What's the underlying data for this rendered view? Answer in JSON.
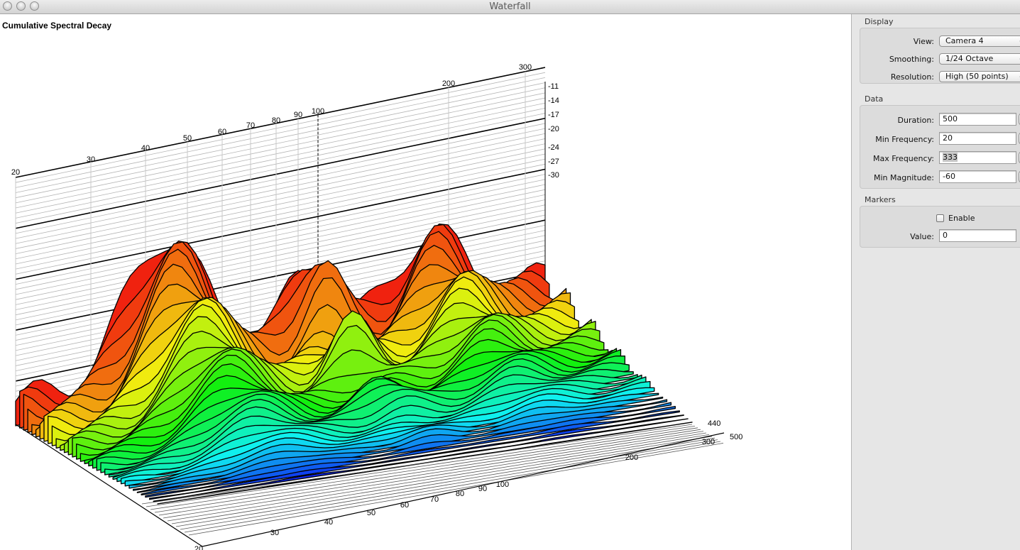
{
  "window": {
    "title": "Waterfall"
  },
  "plot": {
    "title": "Cumulative Spectral Decay",
    "freq_ticks": [
      "20",
      "30",
      "40",
      "50",
      "60",
      "70",
      "80",
      "90",
      "100",
      "200",
      "300"
    ],
    "time_ticks": [
      "300",
      "440",
      "500"
    ],
    "mag_ticks": [
      "-11",
      "-14",
      "-17",
      "-20",
      "-24",
      "-27",
      "-30"
    ]
  },
  "panel": {
    "display": {
      "title": "Display",
      "view_label": "View:",
      "view_value": "Camera 4",
      "smoothing_label": "Smoothing:",
      "smoothing_value": "1/24 Octave",
      "resolution_label": "Resolution:",
      "resolution_value": "High (50 points)"
    },
    "data": {
      "title": "Data",
      "duration_label": "Duration:",
      "duration_value": "500",
      "min_freq_label": "Min Frequency:",
      "min_freq_value": "20",
      "max_freq_label": "Max Frequency:",
      "max_freq_value": "333",
      "min_mag_label": "Min Magnitude:",
      "min_mag_value": "-60"
    },
    "markers": {
      "title": "Markers",
      "enable_label": "Enable",
      "value_label": "Value:",
      "value_value": "0"
    }
  }
}
